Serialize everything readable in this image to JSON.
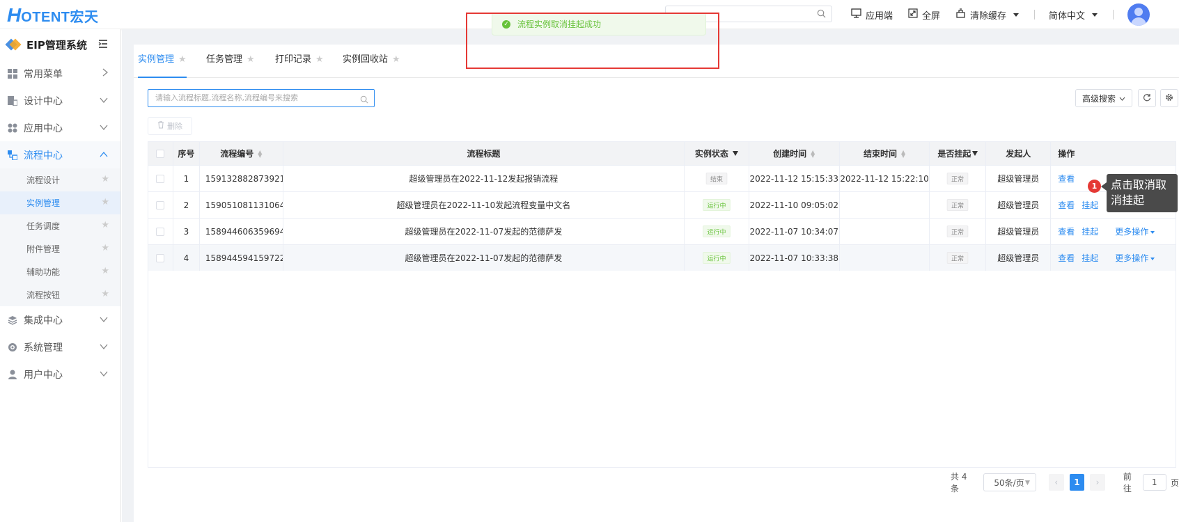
{
  "header": {
    "logo_initial": "H",
    "logo_rest": "OTENT宏天",
    "actions": [
      {
        "label": "应用端",
        "icon": "monitor-icon"
      },
      {
        "label": "全屏",
        "icon": "fullscreen-icon"
      },
      {
        "label": "清除缓存",
        "icon": "clear-cache-icon"
      }
    ],
    "language": "简体中文"
  },
  "toast": {
    "message": "流程实例取消挂起成功",
    "color": "#67c23a"
  },
  "sidebar": {
    "title": "EIP管理系统",
    "menu": [
      {
        "label": "常用菜单",
        "icon": "grid-icon"
      },
      {
        "label": "设计中心",
        "icon": "design-icon"
      },
      {
        "label": "应用中心",
        "icon": "apps-icon"
      },
      {
        "label": "流程中心",
        "icon": "flow-icon"
      },
      {
        "label": "集成中心",
        "icon": "layers-icon"
      },
      {
        "label": "系统管理",
        "icon": "gear-icon"
      },
      {
        "label": "用户中心",
        "icon": "user-icon"
      }
    ],
    "flow_sub": [
      {
        "label": "流程设计"
      },
      {
        "label": "实例管理"
      },
      {
        "label": "任务调度"
      },
      {
        "label": "附件管理"
      },
      {
        "label": "辅助功能"
      },
      {
        "label": "流程按钮"
      }
    ]
  },
  "tabs": [
    {
      "label": "实例管理"
    },
    {
      "label": "任务管理"
    },
    {
      "label": "打印记录"
    },
    {
      "label": "实例回收站"
    }
  ],
  "toolbar": {
    "search_placeholder": "请输入流程标题,流程名称,流程编号来搜索",
    "advanced_search": "高级搜索",
    "delete_label": "删除"
  },
  "table": {
    "headers": {
      "seq": "序号",
      "no": "流程编号",
      "title": "流程标题",
      "state": "实例状态",
      "ctime": "创建时间",
      "etime": "结束时间",
      "suspended": "是否挂起",
      "initiator": "发起人",
      "ops": "操作"
    },
    "rows": [
      {
        "seq": "1",
        "no": "159132882873921...",
        "title": "超级管理员在2022-11-12发起报销流程",
        "state": "结束",
        "ctime": "2022-11-12 15:15:33",
        "etime": "2022-11-12 15:22:10",
        "suspended": "正常",
        "initiator": "超级管理员",
        "view": "查看",
        "suspend": "",
        "more": ""
      },
      {
        "seq": "2",
        "no": "159051081131064...",
        "title": "超级管理员在2022-11-10发起流程变量中文名",
        "state": "运行中",
        "ctime": "2022-11-10 09:05:02",
        "etime": "",
        "suspended": "正常",
        "initiator": "超级管理员",
        "view": "查看",
        "suspend": "挂起",
        "more": ""
      },
      {
        "seq": "3",
        "no": "158944606359694...",
        "title": "超级管理员在2022-11-07发起的范德萨发",
        "state": "运行中",
        "ctime": "2022-11-07 10:34:07",
        "etime": "",
        "suspended": "正常",
        "initiator": "超级管理员",
        "view": "查看",
        "suspend": "挂起",
        "more": "更多操作"
      },
      {
        "seq": "4",
        "no": "158944594159722...",
        "title": "超级管理员在2022-11-07发起的范德萨发",
        "state": "运行中",
        "ctime": "2022-11-07 10:33:38",
        "etime": "",
        "suspended": "正常",
        "initiator": "超级管理员",
        "view": "查看",
        "suspend": "挂起",
        "more": "更多操作"
      }
    ]
  },
  "annotation": {
    "number": "1",
    "text": "点击取消取消挂起"
  },
  "pagination": {
    "total": "共 4 条",
    "page_size": "50条/页",
    "current": "1",
    "goto_label": "前往",
    "goto_value": "1",
    "page_suffix": "页"
  }
}
